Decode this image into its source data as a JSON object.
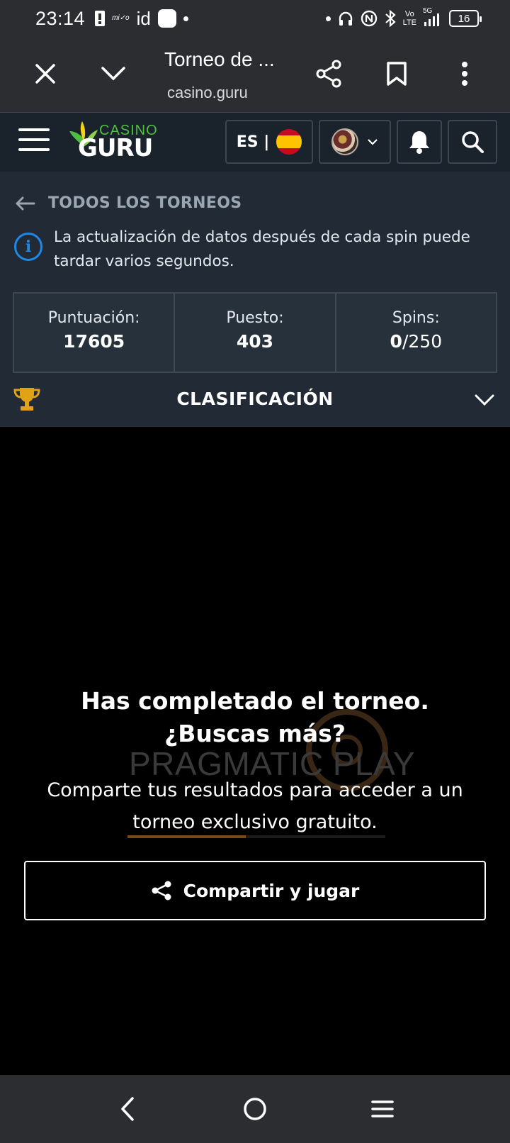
{
  "status_bar": {
    "time": "23:14",
    "carrier_mark": "mi✓o",
    "id_mark": "id",
    "net_top": "Vo",
    "net_bottom": "LTE",
    "net_5g": "5G",
    "battery": "16"
  },
  "browser": {
    "title": "Torneo de ...",
    "url": "casino.guru"
  },
  "site_header": {
    "logo_top": "CASINO",
    "logo_bottom": "GURU",
    "language": "ES |"
  },
  "tournament": {
    "back_label": "TODOS LOS TORNEOS",
    "info_text": "La actualización de datos después de cada spin puede tardar varios segundos.",
    "stats": {
      "score_label": "Puntuación:",
      "score_value": "17605",
      "rank_label": "Puesto:",
      "rank_value": "403",
      "spins_label": "Spins:",
      "spins_used": "0",
      "spins_total": "/250"
    },
    "leaderboard_label": "CLASIFICACIÓN"
  },
  "game": {
    "watermark": "PRAGMATIC PLAY",
    "title": "Has completado el torneo. ¿Buscas más?",
    "subtitle": "Comparte tus resultados para acceder a un torneo exclusivo gratuito.",
    "share_button": "Compartir y jugar",
    "loading_progress": 0.46
  },
  "colors": {
    "accent_blue": "#1e88e5",
    "brand_green": "#4fbf3f",
    "panel": "#222b35",
    "header": "#1a222c"
  }
}
